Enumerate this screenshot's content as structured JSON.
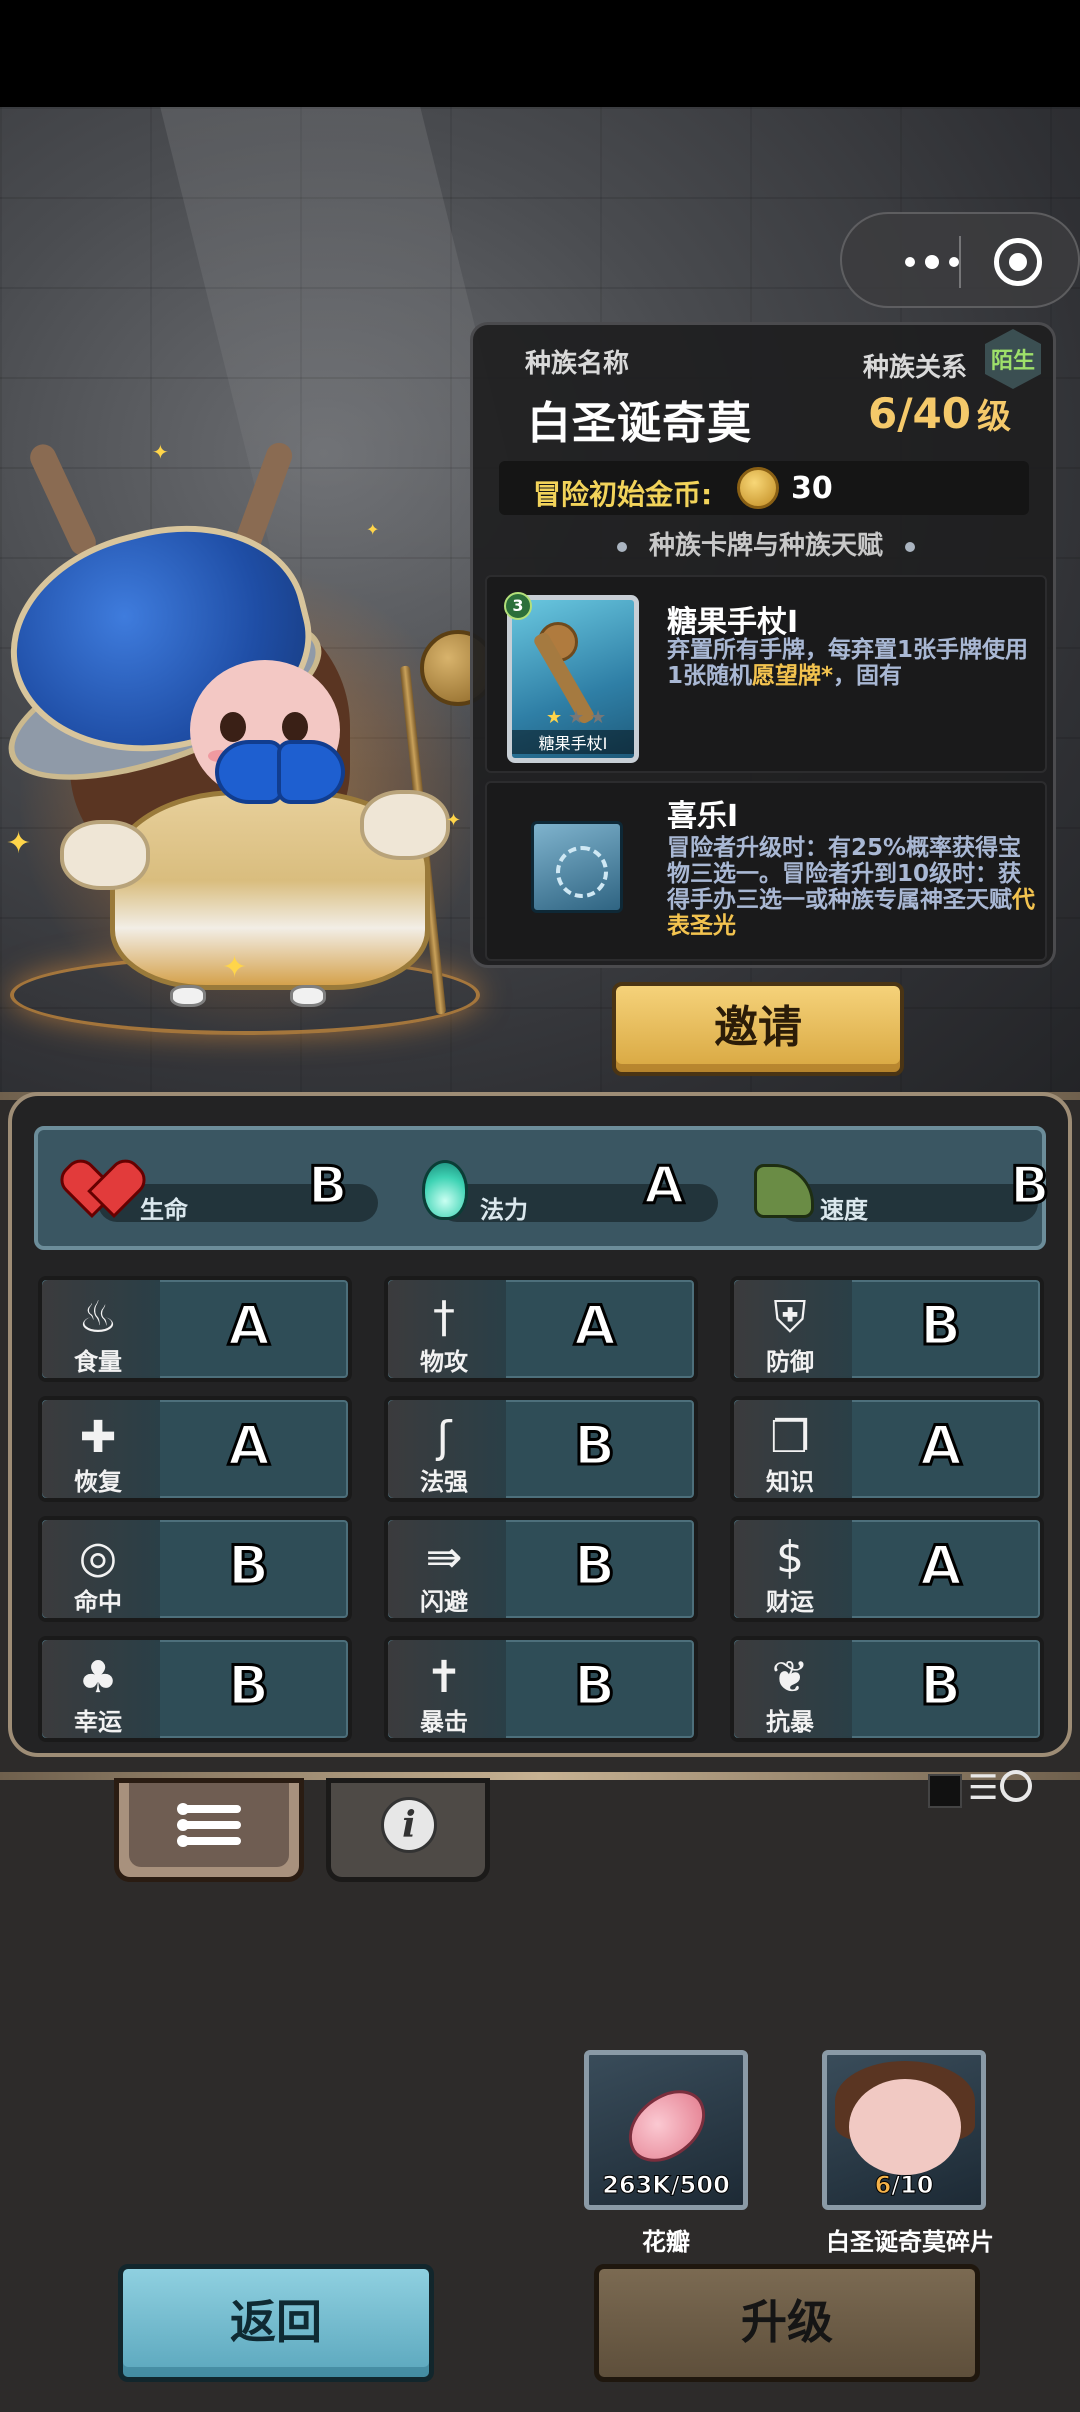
{
  "race": {
    "name_label": "种族名称",
    "name": "白圣诞奇莫",
    "relation_label": "种族关系",
    "relation": "陌生",
    "level": "6/40",
    "level_unit": "级",
    "coin_label": "冒险初始金币:",
    "coin_value": "30",
    "section_title": "种族卡牌与种族天赋"
  },
  "card": {
    "cost": "3",
    "title": "糖果手杖I",
    "thumb_name": "糖果手杖I",
    "desc_a": "弃置所有手牌，每弃置1张手牌使用1张随机",
    "desc_hl": "愿望牌*",
    "desc_b": "，固有"
  },
  "talent": {
    "title": "喜乐I",
    "desc_a": "冒险者升级时：有25%概率获得宝物三选一。冒险者升到10级时：获得手办三选一或种族专属神圣天赋",
    "desc_hl": "代表圣光"
  },
  "invite_label": "邀请",
  "top_stats": [
    {
      "label": "生命",
      "grade": "B",
      "icon": "heart-icon"
    },
    {
      "label": "法力",
      "grade": "A",
      "icon": "mana-flame-icon"
    },
    {
      "label": "速度",
      "grade": "B",
      "icon": "winged-boot-icon"
    }
  ],
  "attributes": [
    {
      "label": "食量",
      "grade": "A",
      "icon": "stomach-icon",
      "glyph": "♨"
    },
    {
      "label": "物攻",
      "grade": "A",
      "icon": "sword-icon",
      "glyph": "†"
    },
    {
      "label": "防御",
      "grade": "B",
      "icon": "armor-icon",
      "glyph": "⛨"
    },
    {
      "label": "恢复",
      "grade": "A",
      "icon": "heart-plus-icon",
      "glyph": "✚"
    },
    {
      "label": "法强",
      "grade": "B",
      "icon": "staff-icon",
      "glyph": "ʃ"
    },
    {
      "label": "知识",
      "grade": "A",
      "icon": "book-icon",
      "glyph": "❐"
    },
    {
      "label": "命中",
      "grade": "B",
      "icon": "target-icon",
      "glyph": "◎"
    },
    {
      "label": "闪避",
      "grade": "B",
      "icon": "dodge-arrows-icon",
      "glyph": "⇛"
    },
    {
      "label": "财运",
      "grade": "A",
      "icon": "coin-icon",
      "glyph": "$"
    },
    {
      "label": "幸运",
      "grade": "B",
      "icon": "clover-icon",
      "glyph": "♣"
    },
    {
      "label": "暴击",
      "grade": "B",
      "icon": "crit-sword-icon",
      "glyph": "✝"
    },
    {
      "label": "抗暴",
      "grade": "B",
      "icon": "shield-flower-icon",
      "glyph": "❦"
    }
  ],
  "resources": [
    {
      "name": "花瓣",
      "current": "263K",
      "required": "500"
    },
    {
      "name": "白圣诞奇莫碎片",
      "current": "6",
      "required": "10"
    }
  ],
  "buttons": {
    "back": "返回",
    "upgrade": "升级"
  }
}
